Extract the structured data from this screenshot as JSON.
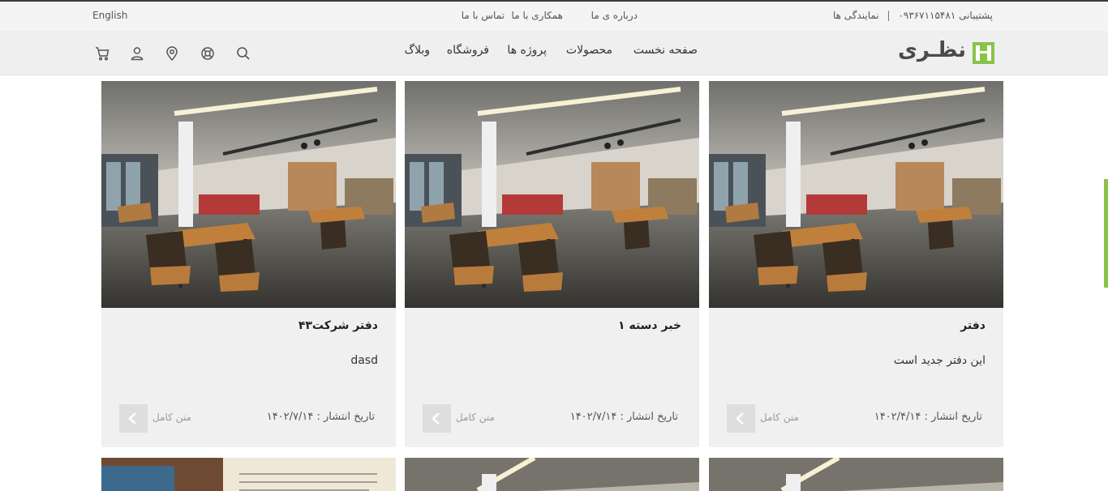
{
  "topbar": {
    "language": "English",
    "links": [
      "درباره ی ما",
      "همکاری با ما",
      "تماس با ما"
    ],
    "support_label": "پشتیبانی",
    "support_phone": "۰۹۳۶۷۱۱۵۴۸۱",
    "separator": "|",
    "agencies": "نمایندگی ها"
  },
  "header": {
    "logo_text": "نظـری",
    "nav": [
      "صفحه نخست",
      "محصولات",
      "پروژه ها",
      "فروشگاه",
      "وبلاگ"
    ],
    "icons": [
      "search-icon",
      "support-icon",
      "location-icon",
      "user-icon",
      "cart-icon"
    ]
  },
  "colors": {
    "accent": "#8bc34a",
    "card_bg": "#f0f0f0",
    "button_bg": "#dedede"
  },
  "cards": [
    {
      "title": "دفتر",
      "excerpt": "این دفتر جدید است",
      "date": "تاریخ انتشار : ۱۴۰۲/۴/۱۴",
      "more": "متن کامل"
    },
    {
      "title": "خبر دسته ۱",
      "excerpt": "",
      "date": "تاریخ انتشار : ۱۴۰۲/۷/۱۴",
      "more": "متن کامل"
    },
    {
      "title": "دفتر شرکت۴۳",
      "excerpt": "dasd",
      "date": "تاریخ انتشار : ۱۴۰۲/۷/۱۴",
      "more": "متن کامل"
    }
  ]
}
